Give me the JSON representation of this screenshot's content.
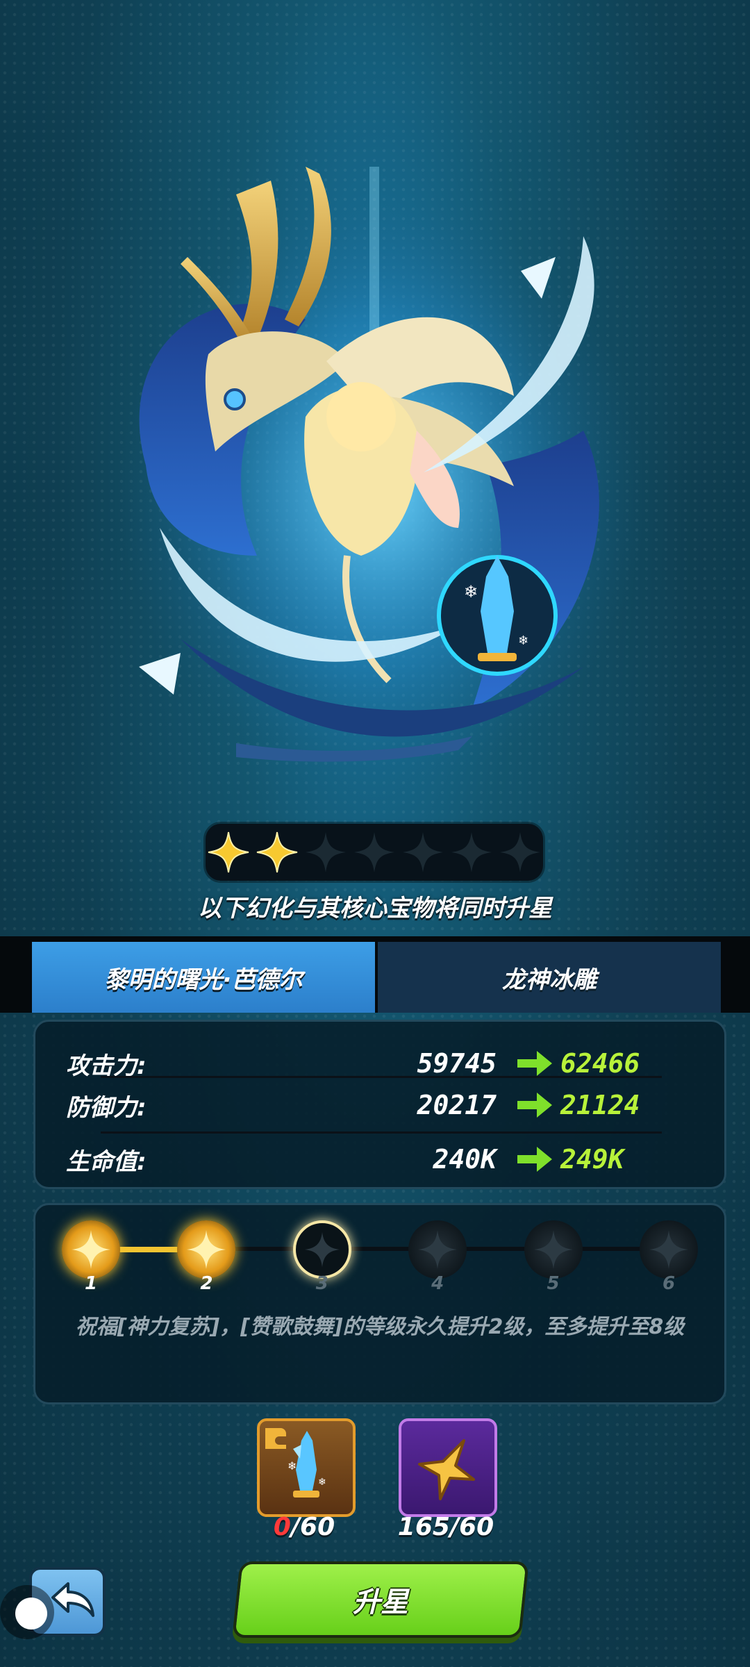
{
  "star_rating": {
    "filled": 2,
    "total": 7
  },
  "notice": "以下幻化与其核心宝物将同时升星",
  "tabs": [
    {
      "label": "黎明的曙光·芭德尔",
      "active": true
    },
    {
      "label": "龙神冰雕",
      "active": false
    }
  ],
  "stats": [
    {
      "label": "攻击力:",
      "current": "59745",
      "next": "62466"
    },
    {
      "label": "防御力:",
      "current": "20217",
      "next": "21124"
    },
    {
      "label": "生命值:",
      "current": "240K",
      "next": "249K"
    }
  ],
  "levels": {
    "nodes": [
      "1",
      "2",
      "3",
      "4",
      "5",
      "6"
    ],
    "completed": 2,
    "current": 3,
    "description": "祝福[神力复苏]，[赞歌鼓舞]的等级永久提升2级，至多提升至8级"
  },
  "costs": [
    {
      "item": "ice-statue-shard-icon",
      "have": "0",
      "need": "/60",
      "insufficient": true
    },
    {
      "item": "gold-star-icon",
      "have": "165",
      "need": "/60",
      "insufficient": false
    }
  ],
  "upgrade_button": "升星",
  "colors": {
    "accent_green": "#b8f23a",
    "tab_active": "#3d9ee6",
    "tab_inactive": "#15324d",
    "gold": "#f3c431",
    "warning_red": "#ff3a3a"
  }
}
